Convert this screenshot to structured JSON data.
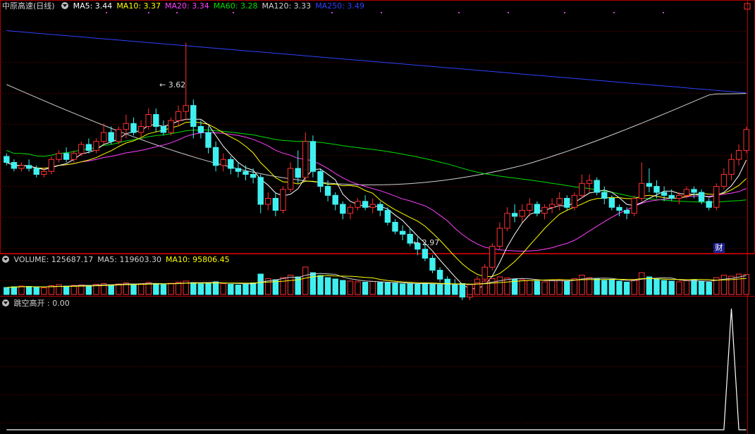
{
  "stock": {
    "name": "中原高速",
    "period": "(日线)"
  },
  "main_panel": {
    "indicators": [
      {
        "label": "MA5: 3.44",
        "color": "#ffffff"
      },
      {
        "label": "MA10: 3.37",
        "color": "#ffff00"
      },
      {
        "label": "MA20: 3.34",
        "color": "#ff40ff"
      },
      {
        "label": "MA60: 3.28",
        "color": "#00e000"
      },
      {
        "label": "MA120: 3.33",
        "color": "#d0d0d0"
      },
      {
        "label": "MA250: 3.49",
        "color": "#3040ff"
      }
    ],
    "high_label": "3.62",
    "low_label": "2.97",
    "badge": "财"
  },
  "volume_panel": {
    "indicators": [
      {
        "label": "VOLUME: 125687.17",
        "color": "#d0d0d0"
      },
      {
        "label": "MA5: 119603.30",
        "color": "#d0d0d0"
      },
      {
        "label": "MA10: 95806.45",
        "color": "#ffff00"
      }
    ]
  },
  "indicator_panel": {
    "indicators": [
      {
        "label": "跳空高开 : 0.00",
        "color": "#d0d0d0"
      }
    ]
  },
  "colors": {
    "up": "#ff3030",
    "down": "#40f0f0",
    "grid": "#7a0000",
    "border": "#b00000"
  },
  "chart_data": {
    "type": "candlestick",
    "price_range": [
      2.92,
      3.72
    ],
    "candles": [
      [
        3.24,
        3.25,
        3.21,
        3.22
      ],
      [
        3.22,
        3.23,
        3.19,
        3.2
      ],
      [
        3.2,
        3.22,
        3.19,
        3.21
      ],
      [
        3.21,
        3.23,
        3.19,
        3.2
      ],
      [
        3.2,
        3.21,
        3.17,
        3.18
      ],
      [
        3.18,
        3.2,
        3.17,
        3.19
      ],
      [
        3.19,
        3.24,
        3.18,
        3.23
      ],
      [
        3.23,
        3.26,
        3.22,
        3.25
      ],
      [
        3.25,
        3.27,
        3.22,
        3.23
      ],
      [
        3.23,
        3.26,
        3.22,
        3.25
      ],
      [
        3.25,
        3.29,
        3.24,
        3.28
      ],
      [
        3.28,
        3.3,
        3.25,
        3.26
      ],
      [
        3.26,
        3.3,
        3.25,
        3.29
      ],
      [
        3.29,
        3.35,
        3.28,
        3.32
      ],
      [
        3.32,
        3.34,
        3.28,
        3.29
      ],
      [
        3.29,
        3.34,
        3.28,
        3.33
      ],
      [
        3.33,
        3.38,
        3.3,
        3.35
      ],
      [
        3.35,
        3.37,
        3.31,
        3.32
      ],
      [
        3.32,
        3.36,
        3.3,
        3.34
      ],
      [
        3.34,
        3.4,
        3.33,
        3.38
      ],
      [
        3.38,
        3.4,
        3.32,
        3.34
      ],
      [
        3.34,
        3.36,
        3.31,
        3.32
      ],
      [
        3.32,
        3.37,
        3.31,
        3.36
      ],
      [
        3.36,
        3.41,
        3.34,
        3.39
      ],
      [
        3.39,
        3.62,
        3.36,
        3.41
      ],
      [
        3.41,
        3.43,
        3.3,
        3.34
      ],
      [
        3.34,
        3.36,
        3.3,
        3.32
      ],
      [
        3.32,
        3.34,
        3.25,
        3.27
      ],
      [
        3.27,
        3.29,
        3.19,
        3.21
      ],
      [
        3.21,
        3.25,
        3.19,
        3.23
      ],
      [
        3.23,
        3.24,
        3.18,
        3.2
      ],
      [
        3.2,
        3.22,
        3.17,
        3.19
      ],
      [
        3.19,
        3.21,
        3.16,
        3.18
      ],
      [
        3.18,
        3.2,
        3.15,
        3.17
      ],
      [
        3.17,
        3.18,
        3.05,
        3.08
      ],
      [
        3.08,
        3.12,
        3.06,
        3.1
      ],
      [
        3.1,
        3.12,
        3.04,
        3.06
      ],
      [
        3.06,
        3.14,
        3.05,
        3.13
      ],
      [
        3.13,
        3.22,
        3.12,
        3.2
      ],
      [
        3.2,
        3.26,
        3.15,
        3.17
      ],
      [
        3.17,
        3.32,
        3.16,
        3.29
      ],
      [
        3.29,
        3.31,
        3.17,
        3.19
      ],
      [
        3.19,
        3.2,
        3.12,
        3.14
      ],
      [
        3.14,
        3.16,
        3.09,
        3.11
      ],
      [
        3.11,
        3.12,
        3.06,
        3.08
      ],
      [
        3.08,
        3.09,
        3.03,
        3.05
      ],
      [
        3.05,
        3.08,
        3.03,
        3.07
      ],
      [
        3.07,
        3.1,
        3.06,
        3.09
      ],
      [
        3.09,
        3.11,
        3.06,
        3.07
      ],
      [
        3.07,
        3.1,
        3.05,
        3.08
      ],
      [
        3.08,
        3.09,
        3.04,
        3.06
      ],
      [
        3.06,
        3.07,
        3.01,
        3.02
      ],
      [
        3.02,
        3.03,
        2.98,
        2.99
      ],
      [
        2.99,
        3.01,
        2.96,
        2.98
      ],
      [
        2.98,
        3.0,
        2.94,
        2.95
      ],
      [
        2.95,
        2.97,
        2.91,
        2.93
      ],
      [
        2.93,
        2.95,
        2.89,
        2.9
      ],
      [
        2.9,
        2.91,
        2.85,
        2.86
      ],
      [
        2.86,
        2.87,
        2.82,
        2.83
      ],
      [
        2.83,
        2.84,
        2.8,
        2.81
      ],
      [
        2.81,
        2.83,
        2.78,
        2.79
      ],
      [
        2.79,
        2.81,
        2.76,
        2.77
      ],
      [
        2.77,
        2.8,
        2.76,
        2.79
      ],
      [
        2.79,
        2.84,
        2.78,
        2.83
      ],
      [
        2.83,
        2.88,
        2.82,
        2.87
      ],
      [
        2.87,
        2.95,
        2.86,
        2.94
      ],
      [
        2.94,
        3.02,
        2.93,
        3.0
      ],
      [
        3.0,
        3.07,
        2.99,
        3.05
      ],
      [
        3.05,
        3.08,
        3.02,
        3.04
      ],
      [
        3.04,
        3.08,
        3.02,
        3.06
      ],
      [
        3.06,
        3.1,
        3.04,
        3.08
      ],
      [
        3.08,
        3.09,
        3.04,
        3.05
      ],
      [
        3.05,
        3.08,
        3.03,
        3.07
      ],
      [
        3.07,
        3.1,
        3.05,
        3.08
      ],
      [
        3.08,
        3.12,
        3.06,
        3.1
      ],
      [
        3.1,
        3.11,
        3.06,
        3.07
      ],
      [
        3.07,
        3.12,
        3.06,
        3.11
      ],
      [
        3.11,
        3.18,
        3.1,
        3.15
      ],
      [
        3.15,
        3.18,
        3.12,
        3.16
      ],
      [
        3.16,
        3.17,
        3.11,
        3.12
      ],
      [
        3.12,
        3.14,
        3.08,
        3.1
      ],
      [
        3.1,
        3.11,
        3.06,
        3.07
      ],
      [
        3.07,
        3.08,
        3.04,
        3.06
      ],
      [
        3.06,
        3.07,
        3.03,
        3.05
      ],
      [
        3.05,
        3.11,
        3.04,
        3.1
      ],
      [
        3.1,
        3.22,
        3.09,
        3.15
      ],
      [
        3.15,
        3.2,
        3.12,
        3.14
      ],
      [
        3.14,
        3.16,
        3.1,
        3.12
      ],
      [
        3.12,
        3.14,
        3.09,
        3.11
      ],
      [
        3.11,
        3.13,
        3.09,
        3.1
      ],
      [
        3.1,
        3.12,
        3.08,
        3.11
      ],
      [
        3.11,
        3.14,
        3.1,
        3.13
      ],
      [
        3.13,
        3.14,
        3.1,
        3.12
      ],
      [
        3.12,
        3.13,
        3.08,
        3.09
      ],
      [
        3.09,
        3.1,
        3.06,
        3.07
      ],
      [
        3.07,
        3.15,
        3.06,
        3.14
      ],
      [
        3.14,
        3.2,
        3.13,
        3.18
      ],
      [
        3.18,
        3.25,
        3.16,
        3.23
      ],
      [
        3.23,
        3.28,
        3.21,
        3.26
      ],
      [
        3.26,
        3.34,
        3.25,
        3.33
      ]
    ],
    "volumes": [
      20,
      22,
      24,
      23,
      21,
      19,
      25,
      28,
      24,
      26,
      27,
      25,
      29,
      31,
      27,
      30,
      33,
      29,
      31,
      34,
      30,
      28,
      32,
      35,
      38,
      34,
      30,
      33,
      36,
      31,
      29,
      27,
      30,
      33,
      58,
      45,
      42,
      48,
      55,
      50,
      78,
      62,
      54,
      48,
      44,
      40,
      38,
      36,
      35,
      37,
      34,
      33,
      32,
      30,
      31,
      29,
      33,
      30,
      28,
      27,
      29,
      31,
      28,
      33,
      38,
      45,
      50,
      47,
      44,
      42,
      40,
      38,
      36,
      40,
      42,
      38,
      45,
      55,
      48,
      44,
      40,
      42,
      38,
      35,
      41,
      62,
      50,
      44,
      40,
      38,
      36,
      39,
      42,
      37,
      35,
      48,
      55,
      52,
      58,
      57
    ],
    "volume_range": [
      0,
      80
    ],
    "indicator_series": {
      "name": "跳空高开",
      "values": [
        0,
        0,
        0,
        0,
        0,
        0,
        0,
        0,
        0,
        0,
        0,
        0,
        0,
        0,
        0,
        0,
        0,
        0,
        0,
        0,
        0,
        0,
        0,
        0,
        0,
        0,
        0,
        0,
        0,
        0,
        0,
        0,
        0,
        0,
        0,
        0,
        0,
        0,
        0,
        0,
        0,
        0,
        0,
        0,
        0,
        0,
        0,
        0,
        0,
        0,
        0,
        0,
        0,
        0,
        0,
        0,
        0,
        0,
        0,
        0,
        0,
        0,
        0,
        0,
        0,
        0,
        0,
        0,
        0,
        0,
        0,
        0,
        0,
        0,
        0,
        0,
        0,
        0,
        0,
        0,
        0,
        0,
        0,
        0,
        0,
        0,
        0,
        0,
        0,
        0,
        0,
        0,
        0,
        0,
        0,
        0,
        0,
        1,
        0,
        0
      ],
      "range": [
        0,
        1
      ]
    }
  }
}
